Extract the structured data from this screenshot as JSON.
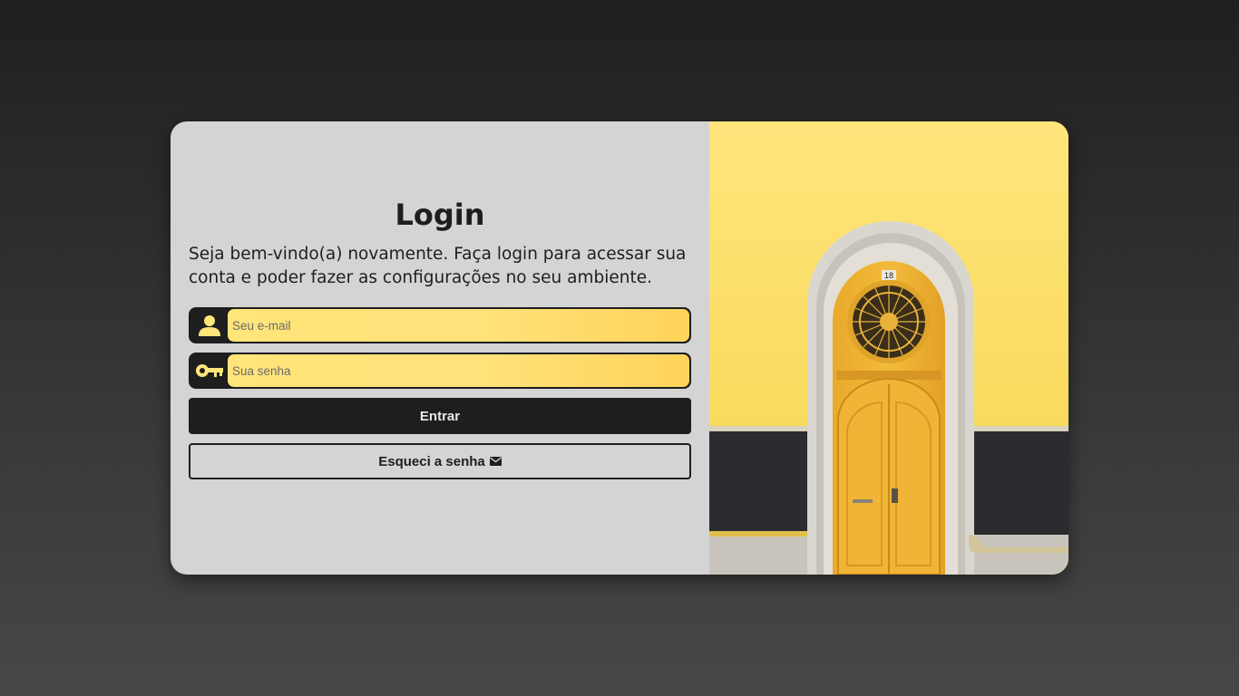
{
  "login": {
    "title": "Login",
    "subtitle": "Seja bem-vindo(a) novamente. Faça login para acessar sua conta e poder fazer as configurações no seu ambiente.",
    "email_placeholder": "Seu e-mail",
    "password_placeholder": "Sua senha",
    "enter_label": "Entrar",
    "forgot_label": "Esqueci a senha",
    "email_icon": "user-icon",
    "password_icon": "key-icon",
    "forgot_icon": "envelope-icon"
  },
  "image": {
    "description_icon": "door-photo",
    "door_number": "18"
  },
  "colors": {
    "accent": "#ffe57a",
    "dark": "#1e1e1e",
    "panel": "#d4d4d4"
  }
}
